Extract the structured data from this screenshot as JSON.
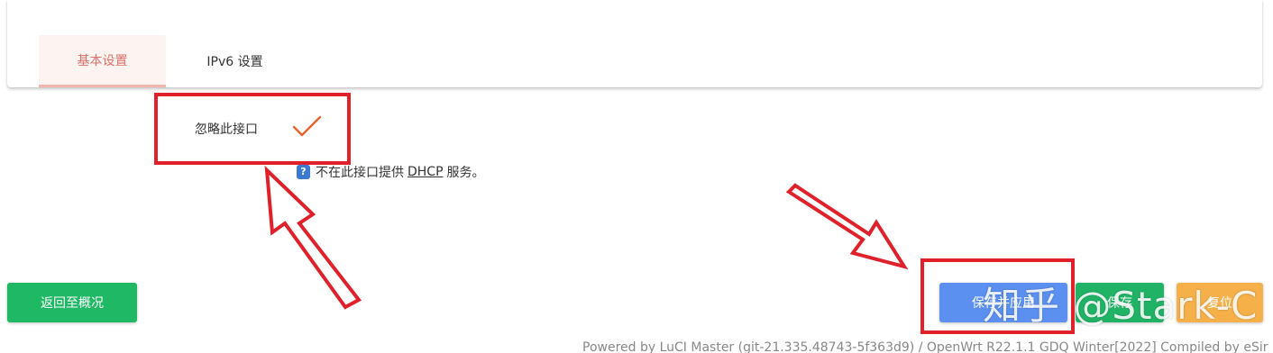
{
  "tabs": [
    {
      "label": "基本设置",
      "active": true
    },
    {
      "label": "IPv6 设置",
      "active": false
    }
  ],
  "ignore_interface": {
    "label": "忽略此接口",
    "checked": true,
    "help_prefix": "不在此接口提供",
    "help_link": "DHCP",
    "help_suffix": "服务。",
    "help_icon": "?"
  },
  "buttons": {
    "back": "返回至概况",
    "apply": "保存并应用",
    "save": "保存",
    "reset": "复位"
  },
  "footer": "Powered by LuCI Master (git-21.335.48743-5f363d9) / OpenWrt R22.1.1 GDQ Winter[2022] Compiled by eSir",
  "watermark": "知乎 @Stark-C",
  "colors": {
    "annotation_red": "#e0202a",
    "accent_tab": "#d9706a",
    "green": "#1fb966",
    "blue": "#5b8ff0",
    "orange": "#f5b049"
  }
}
